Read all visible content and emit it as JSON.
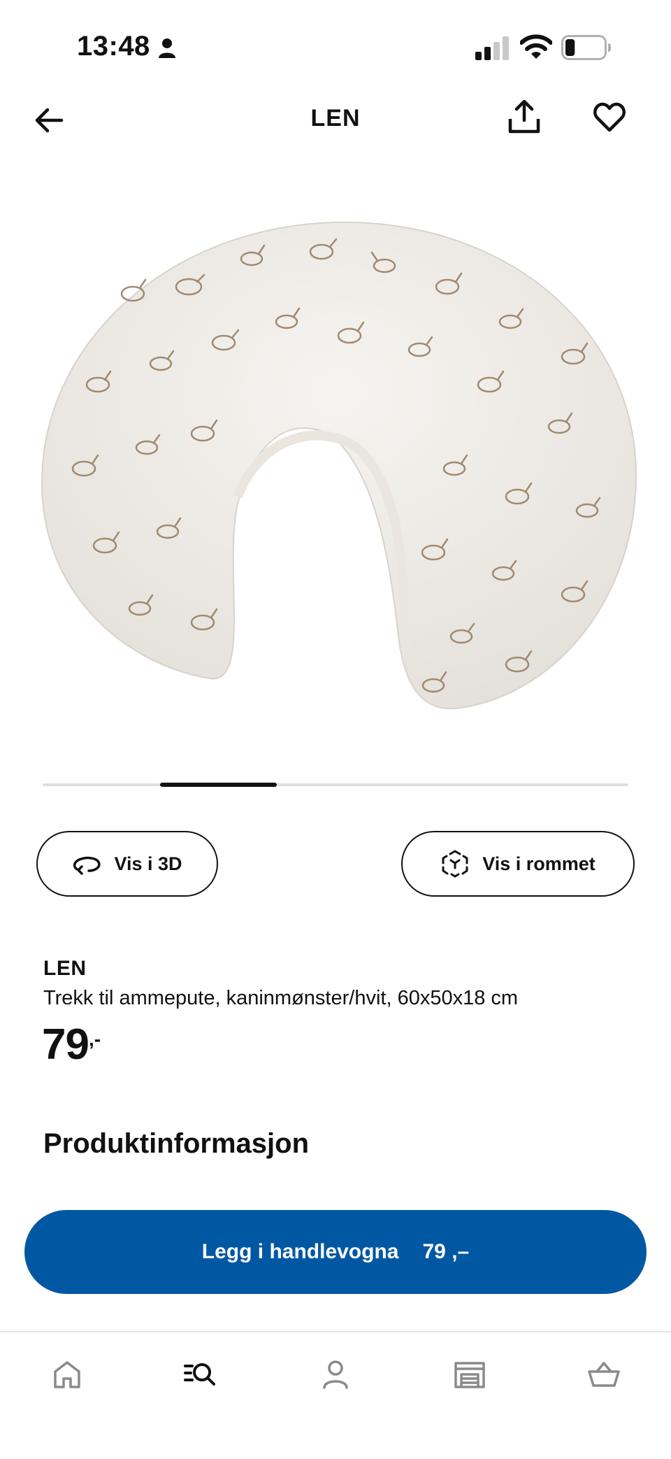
{
  "status_bar": {
    "time": "13:48",
    "battery_level": 0.25
  },
  "header": {
    "title": "LEN"
  },
  "carousel": {
    "current_index": 1,
    "total": 5
  },
  "actions": {
    "view_3d_label": "Vis i 3D",
    "view_room_label": "Vis i rommet"
  },
  "product": {
    "name": "LEN",
    "description": "Trekk til ammepute, kaninmønster/hvit, 60x50x18 cm",
    "price": "79",
    "price_suffix": ",-"
  },
  "section": {
    "title": "Produktinformasjon"
  },
  "cart_button": {
    "label": "Legg i handlevogna",
    "price": "79 ,–"
  },
  "tabs": [
    {
      "icon": "home-icon"
    },
    {
      "icon": "search-list-icon",
      "active": true
    },
    {
      "icon": "profile-icon"
    },
    {
      "icon": "store-icon"
    },
    {
      "icon": "cart-icon"
    }
  ],
  "colors": {
    "primary": "#0058a3",
    "text": "#111111",
    "product_print": "#a08a70"
  }
}
